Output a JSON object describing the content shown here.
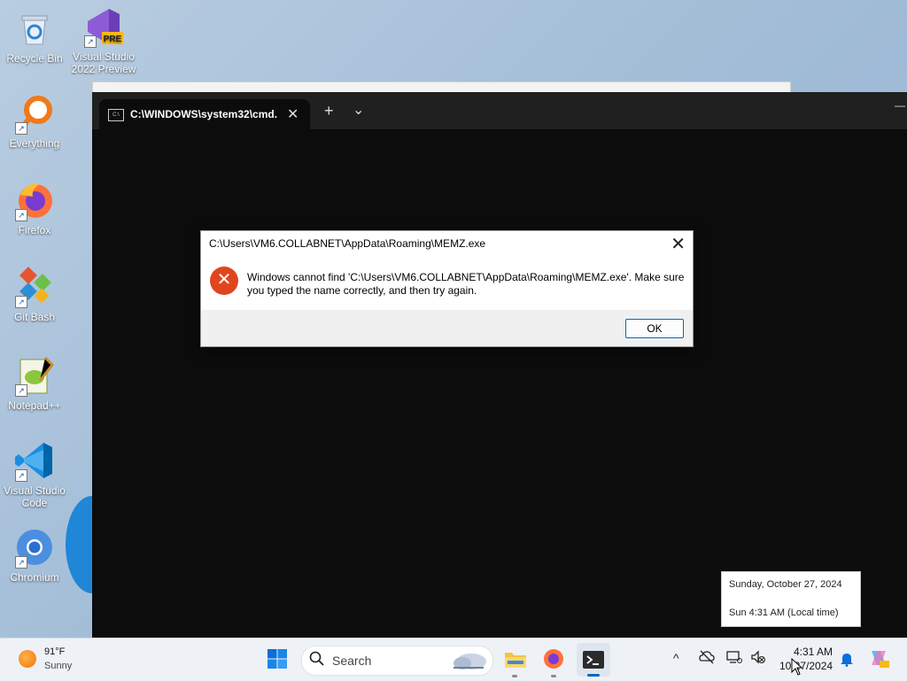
{
  "desktop": {
    "icons": [
      {
        "label": "Recycle Bin",
        "icon": "recycle-bin-icon"
      },
      {
        "label": "Visual Studio 2022 Preview",
        "icon": "visual-studio-icon",
        "badge": "PRE"
      },
      {
        "label": "Everything",
        "icon": "everything-search-icon"
      },
      {
        "label": "Firefox",
        "icon": "firefox-icon"
      },
      {
        "label": "Git Bash",
        "icon": "git-bash-icon"
      },
      {
        "label": "Notepad++",
        "icon": "notepad-plus-plus-icon"
      },
      {
        "label": "Visual Studio Code",
        "icon": "vscode-icon"
      },
      {
        "label": "Chromium",
        "icon": "chromium-icon"
      }
    ]
  },
  "terminal": {
    "tab_title": "C:\\WINDOWS\\system32\\cmd.",
    "tab_icon_text": "C:\\",
    "close_glyph": "✕",
    "new_tab_glyph": "+",
    "dropdown_glyph": "⌄",
    "minimize_glyph": "—"
  },
  "dialog": {
    "title": "C:\\Users\\VM6.COLLABNET\\AppData\\Roaming\\MEMZ.exe",
    "message": "Windows cannot find 'C:\\Users\\VM6.COLLABNET\\AppData\\Roaming\\MEMZ.exe'. Make sure you typed the name correctly, and then try again.",
    "ok_label": "OK",
    "close_glyph": "✕",
    "error_glyph": "✕"
  },
  "clock_popup": {
    "date_line": "Sunday, October 27, 2024",
    "time_line": "Sun 4:31 AM (Local time)"
  },
  "taskbar": {
    "weather": {
      "temp": "91°F",
      "condition": "Sunny"
    },
    "search_placeholder": "Search",
    "clock": {
      "time": "4:31 AM",
      "date": "10/27/2024"
    },
    "tray_chevron": "^"
  },
  "colors": {
    "accent": "#0067c0",
    "error": "#e0461e",
    "terminal_bg": "#0c0c0c"
  }
}
